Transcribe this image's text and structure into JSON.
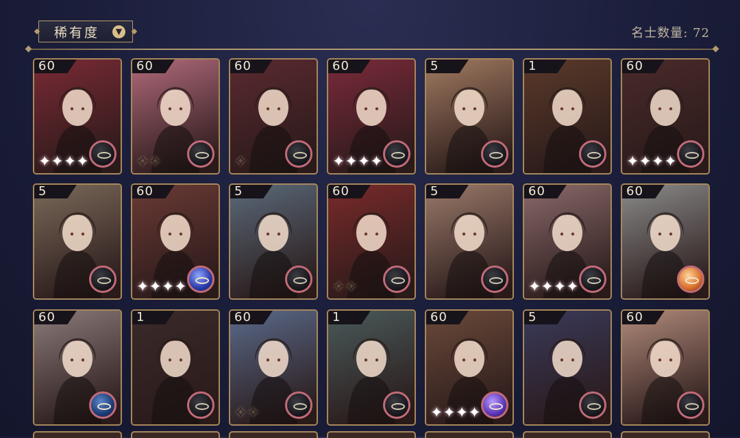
{
  "filter": {
    "label": "稀有度",
    "icon": "chevron-down-icon"
  },
  "count_text": "名士数量: 72",
  "cards": [
    {
      "level": "60",
      "sparkles": "✦✦✦✦",
      "elem": "dark",
      "bg": "#7a2a35"
    },
    {
      "level": "60",
      "sparkles": "✧✧",
      "elem": "dark",
      "bg": "#b06a7a"
    },
    {
      "level": "60",
      "sparkles": "✧",
      "elem": "dark",
      "bg": "#5a2a30"
    },
    {
      "level": "60",
      "sparkles": "✦✦✦✦",
      "elem": "dark",
      "bg": "#7a2a3a"
    },
    {
      "level": "5",
      "sparkles": "",
      "elem": "dark",
      "bg": "#a07a60"
    },
    {
      "level": "1",
      "sparkles": "",
      "elem": "dark",
      "bg": "#5a3a2a"
    },
    {
      "level": "60",
      "sparkles": "✦✦✦✦",
      "elem": "dark",
      "bg": "#4a2a2a"
    },
    {
      "level": "5",
      "sparkles": "",
      "elem": "dark",
      "bg": "#7a6a5a"
    },
    {
      "level": "60",
      "sparkles": "✦✦✦✦",
      "elem": "blue",
      "bg": "#6a3a35"
    },
    {
      "level": "5",
      "sparkles": "",
      "elem": "dark",
      "bg": "#5a6a7a"
    },
    {
      "level": "60",
      "sparkles": "✧✧",
      "elem": "dark",
      "bg": "#7a2a2a"
    },
    {
      "level": "5",
      "sparkles": "",
      "elem": "dark",
      "bg": "#9a7a6a"
    },
    {
      "level": "60",
      "sparkles": "✦✦✦✦",
      "elem": "dark",
      "bg": "#8a6a6a"
    },
    {
      "level": "60",
      "sparkles": "",
      "elem": "gold",
      "bg": "#8a8a8a"
    },
    {
      "level": "60",
      "sparkles": "",
      "elem": "navy",
      "bg": "#8a7a7a"
    },
    {
      "level": "1",
      "sparkles": "",
      "elem": "dark",
      "bg": "#3a2a2a"
    },
    {
      "level": "60",
      "sparkles": "✧✧",
      "elem": "dark",
      "bg": "#5a6a8a"
    },
    {
      "level": "1",
      "sparkles": "",
      "elem": "dark",
      "bg": "#4a5a5a"
    },
    {
      "level": "60",
      "sparkles": "✦✦✦✦",
      "elem": "purple",
      "bg": "#6a4a3a"
    },
    {
      "level": "5",
      "sparkles": "",
      "elem": "dark",
      "bg": "#3a3a5a"
    },
    {
      "level": "60",
      "sparkles": "",
      "elem": "dark",
      "bg": "#b08a7a"
    }
  ]
}
